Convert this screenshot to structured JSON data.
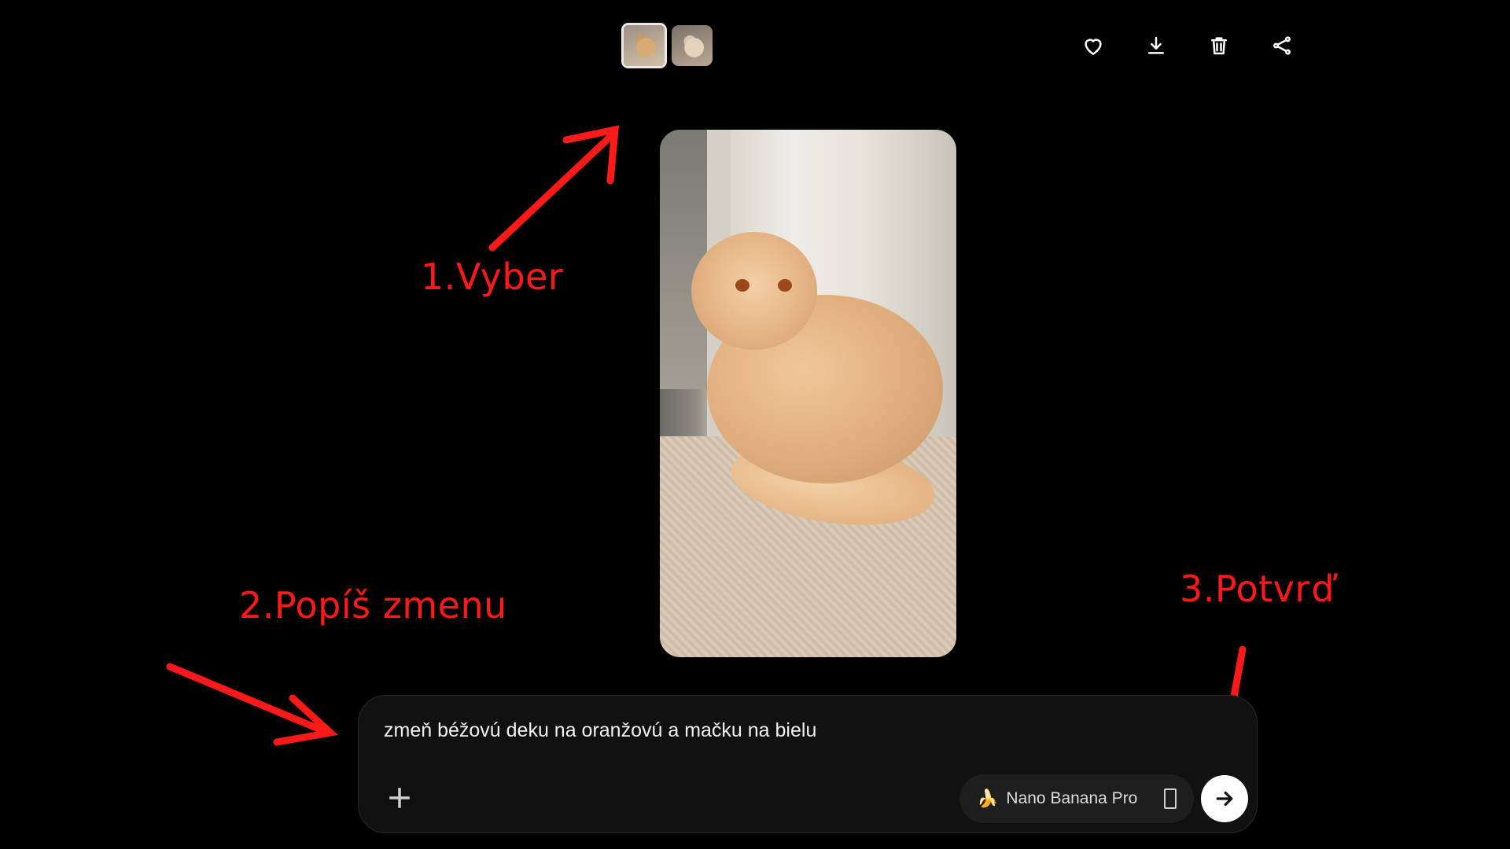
{
  "thumbnails": [
    {
      "label": "thumbnail-1",
      "selected": true
    },
    {
      "label": "thumbnail-2",
      "selected": false
    }
  ],
  "toolbar": {
    "icons": [
      "heart-icon",
      "download-icon",
      "trash-icon",
      "share-icon"
    ]
  },
  "annotations": {
    "step1": "1.Vyber",
    "step2": "2.Popíš zmenu",
    "step3": "3.Potvrď",
    "color": "#ff1a1a"
  },
  "composer": {
    "prompt_text": "zmeň béžovú deku na oranžovú a mačku na bielu",
    "model_label": "Nano Banana Pro"
  },
  "colors": {
    "background": "#000000",
    "composer_bg": "#111111",
    "send_button": "#ffffff"
  }
}
